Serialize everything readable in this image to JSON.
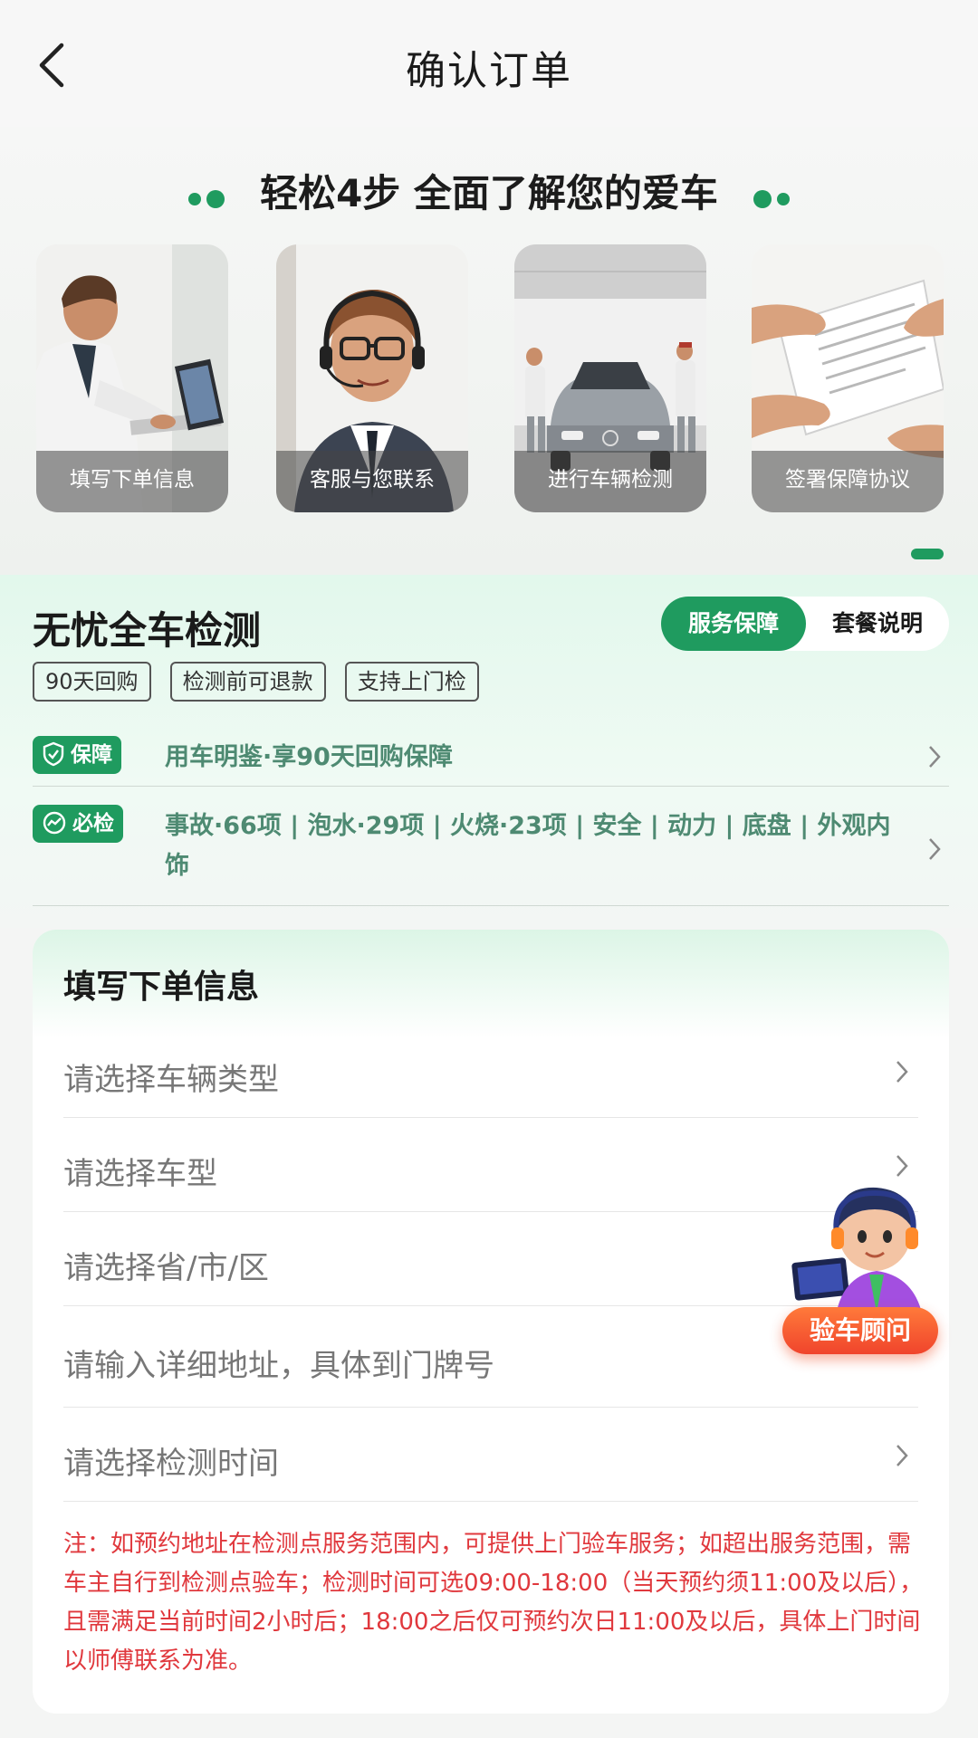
{
  "header": {
    "title": "确认订单",
    "back_icon": "chevron-left-icon"
  },
  "hero": {
    "title": "轻松4步 全面了解您的爱车",
    "steps": [
      {
        "label": "填写下单信息",
        "image": "man-typing-laptop"
      },
      {
        "label": "客服与您联系",
        "image": "agent-with-headset"
      },
      {
        "label": "进行车辆检测",
        "image": "car-inspection-garage"
      },
      {
        "label": "签署保障协议",
        "image": "signing-document"
      }
    ]
  },
  "service": {
    "title": "无忧全车检测",
    "segments": {
      "active": "服务保障",
      "inactive": "套餐说明"
    },
    "tags": [
      "90天回购",
      "检测前可退款",
      "支持上门检"
    ],
    "guarantee": {
      "badge": "保障",
      "text": "用车明鉴·享90天回购保障"
    },
    "inspect": {
      "badge": "必检",
      "text": "事故·66项 | 泡水·29项 | 火烧·23项 | 安全 | 动力 | 底盘 | 外观内饰"
    }
  },
  "form": {
    "title": "填写下单信息",
    "fields": {
      "vehicle_type": "请选择车辆类型",
      "car_model": "请选择车型",
      "region": "请选择省/市/区",
      "address": "请输入详细地址，具体到门牌号",
      "time": "请选择检测时间"
    },
    "note": "注：如预约地址在检测点服务范围内，可提供上门验车服务；如超出服务范围，需车主自行到检测点验车；检测时间可选09:00-18:00（当天预约须11:00及以后），且需满足当前时间2小时后；18:00之后仅可预约次日11:00及以后，具体上门时间以师傅联系为准。"
  },
  "advisor": {
    "label": "验车顾问"
  },
  "colors": {
    "accent": "#1f9b5f",
    "warning": "#e0383d",
    "advisor": "#f0552f"
  }
}
